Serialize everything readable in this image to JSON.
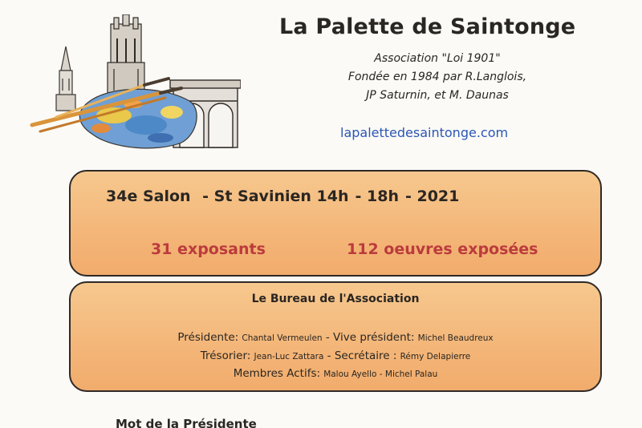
{
  "header": {
    "title": "La Palette de Saintonge",
    "association": "Association \"Loi 1901\"",
    "founded_line1": "Fondée en 1984 par R.Langlois,",
    "founded_line2": "JP Saturnin, et M. Daunas",
    "website": "lapalettedesaintonge.com"
  },
  "salon": {
    "part1": "34e Salon",
    "part2": "- St Savinien 14h",
    "part3": "- 18h",
    "part4": "- 2021",
    "exposants": "31 exposants",
    "oeuvres": "112 oeuvres exposées"
  },
  "bureau": {
    "title": "Le Bureau de l'Association",
    "presidente_label": "Présidente:",
    "presidente_name": "Chantal Vermeulen",
    "sep1": " - ",
    "vice_label": "Vive président:",
    "vice_name": "Michel Beaudreux",
    "tresorier_label": "Trésorier:",
    "tresorier_name": "Jean-Luc Zattara",
    "sep2": " - ",
    "secretaire_label": "Secrétaire :",
    "secretaire_name": "Rémy Delapierre",
    "membres_label": "Membres Actifs:",
    "membres_names": "Malou Ayello - Michel Palau"
  },
  "footer": {
    "mot": "Mot de la Présidente"
  },
  "colors": {
    "box_fill": "#f4b77a",
    "count_red": "#bb3b3d",
    "link_blue": "#2b56b5"
  }
}
